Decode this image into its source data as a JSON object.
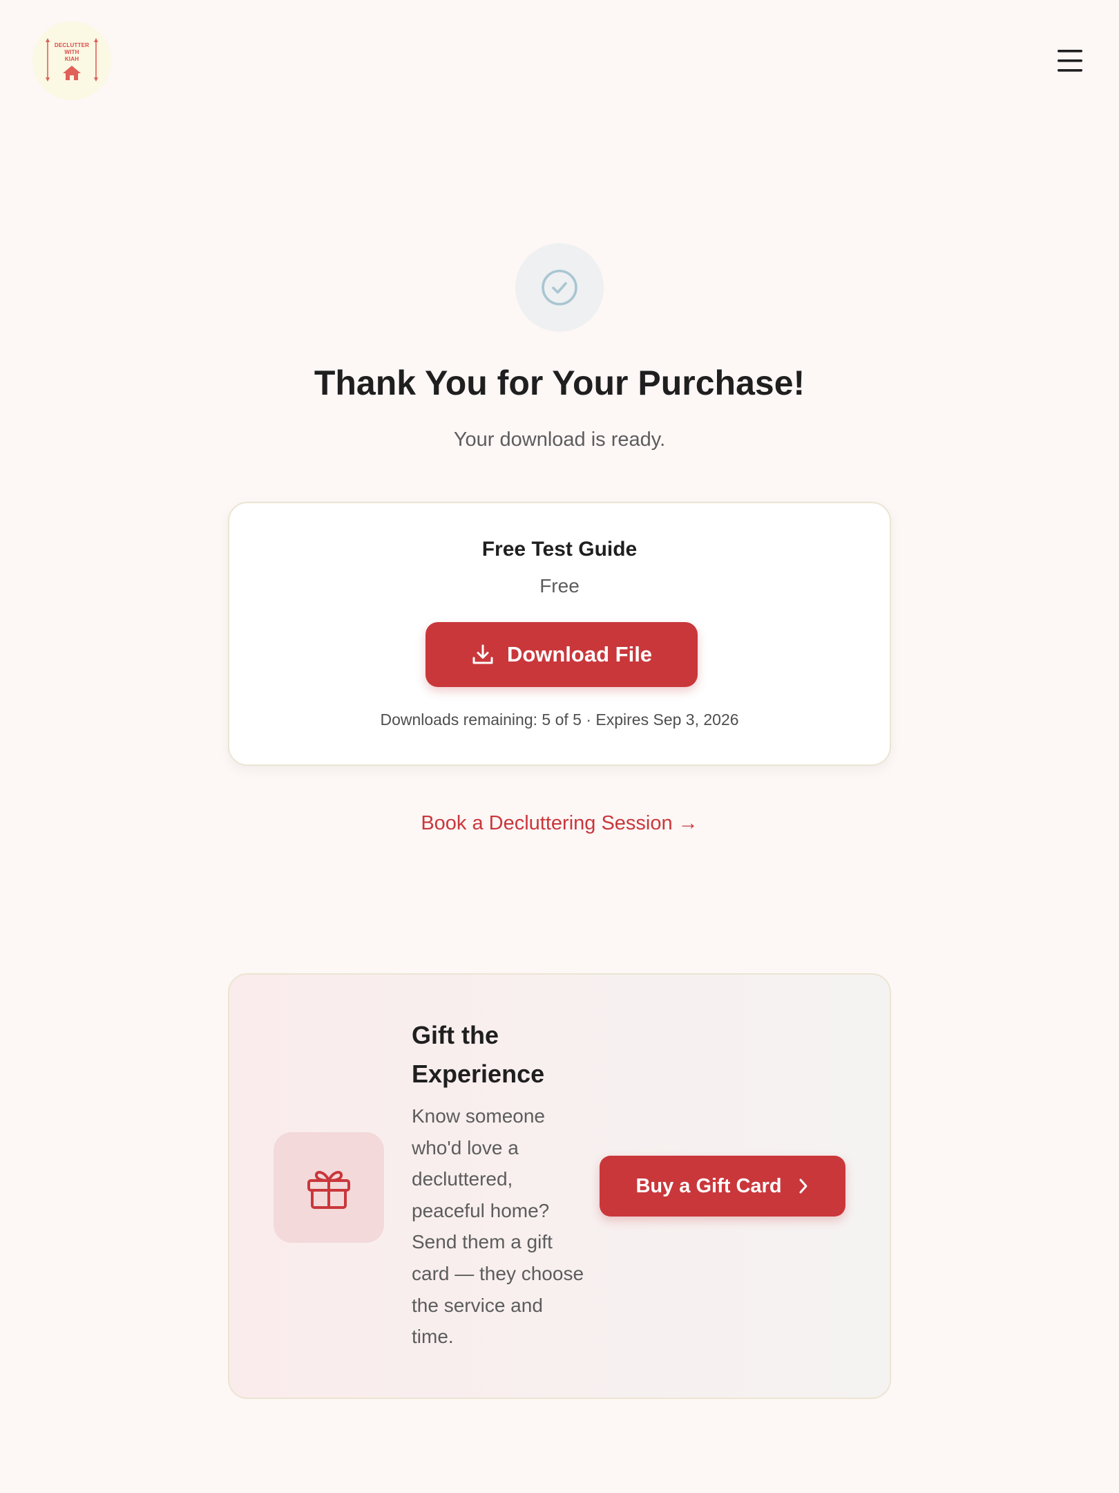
{
  "header": {
    "logo_lines": [
      "DECLUTTER",
      "WITH",
      "KIAH"
    ],
    "menu_icon": "hamburger-menu-icon"
  },
  "hero": {
    "icon": "check-circle-icon",
    "title": "Thank You for Your Purchase!",
    "subtitle": "Your download is ready."
  },
  "product": {
    "name": "Free Test Guide",
    "price": "Free",
    "download_label": "Download File",
    "download_icon": "download-icon",
    "meta": "Downloads remaining: 5 of 5 · Expires Sep 3, 2026"
  },
  "book_link": "Book a Decluttering Session →",
  "gift": {
    "icon": "gift-icon",
    "title": "Gift the Experience",
    "text": "Know someone who'd love a decluttered, peaceful home? Send them a gift card — they choose the service and time.",
    "button_label": "Buy a Gift Card",
    "button_icon": "chevron-right-icon"
  },
  "colors": {
    "background": "#fdf7f6",
    "accent": "#c9373b",
    "border": "#ebe5d2",
    "logo_bg": "#fbf8e3"
  }
}
